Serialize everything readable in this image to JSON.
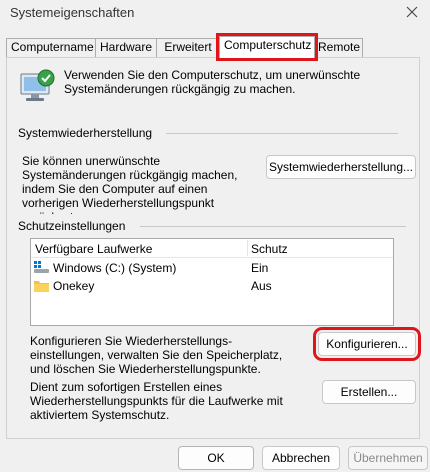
{
  "window": {
    "title": "Systemeigenschaften"
  },
  "tabs": [
    {
      "label": "Computername",
      "active": false
    },
    {
      "label": "Hardware",
      "active": false
    },
    {
      "label": "Erweitert",
      "active": false
    },
    {
      "label": "Computerschutz",
      "active": true
    },
    {
      "label": "Remote",
      "active": false
    }
  ],
  "intro": {
    "text": "Verwenden Sie den Computerschutz, um unerwünschte Systemänderungen rückgängig zu machen."
  },
  "restore": {
    "group_title": "Systemwiederherstellung",
    "text": "Sie können unerwünschte Systemänderungen rückgängig machen, indem Sie den Computer auf einen vorherigen Wiederherstellungspunkt zurücksetzen.",
    "button_label": "Systemwiederherstellung..."
  },
  "protection": {
    "group_title": "Schutzeinstellungen",
    "columns": [
      "Verfügbare Laufwerke",
      "Schutz"
    ],
    "drives": [
      {
        "name": "Windows (C:) (System)",
        "status": "Ein",
        "icon": "system-drive-icon"
      },
      {
        "name": "Onekey",
        "status": "Aus",
        "icon": "folder-icon"
      }
    ],
    "configure_text": "Konfigurieren Sie Wiederherstellungs-einstellungen, verwalten Sie den Speicherplatz, und löschen Sie Wiederherstellungspunkte.",
    "configure_label": "Konfigurieren...",
    "create_text": "Dient zum sofortigen Erstellen eines Wiederherstellungspunkts für die Laufwerke mit aktiviertem Systemschutz.",
    "create_label": "Erstellen..."
  },
  "footer": {
    "ok_label": "OK",
    "cancel_label": "Abbrechen",
    "apply_label": "Übernehmen"
  },
  "colors": {
    "highlight": "#e0151b",
    "accent": "#0067c0"
  }
}
